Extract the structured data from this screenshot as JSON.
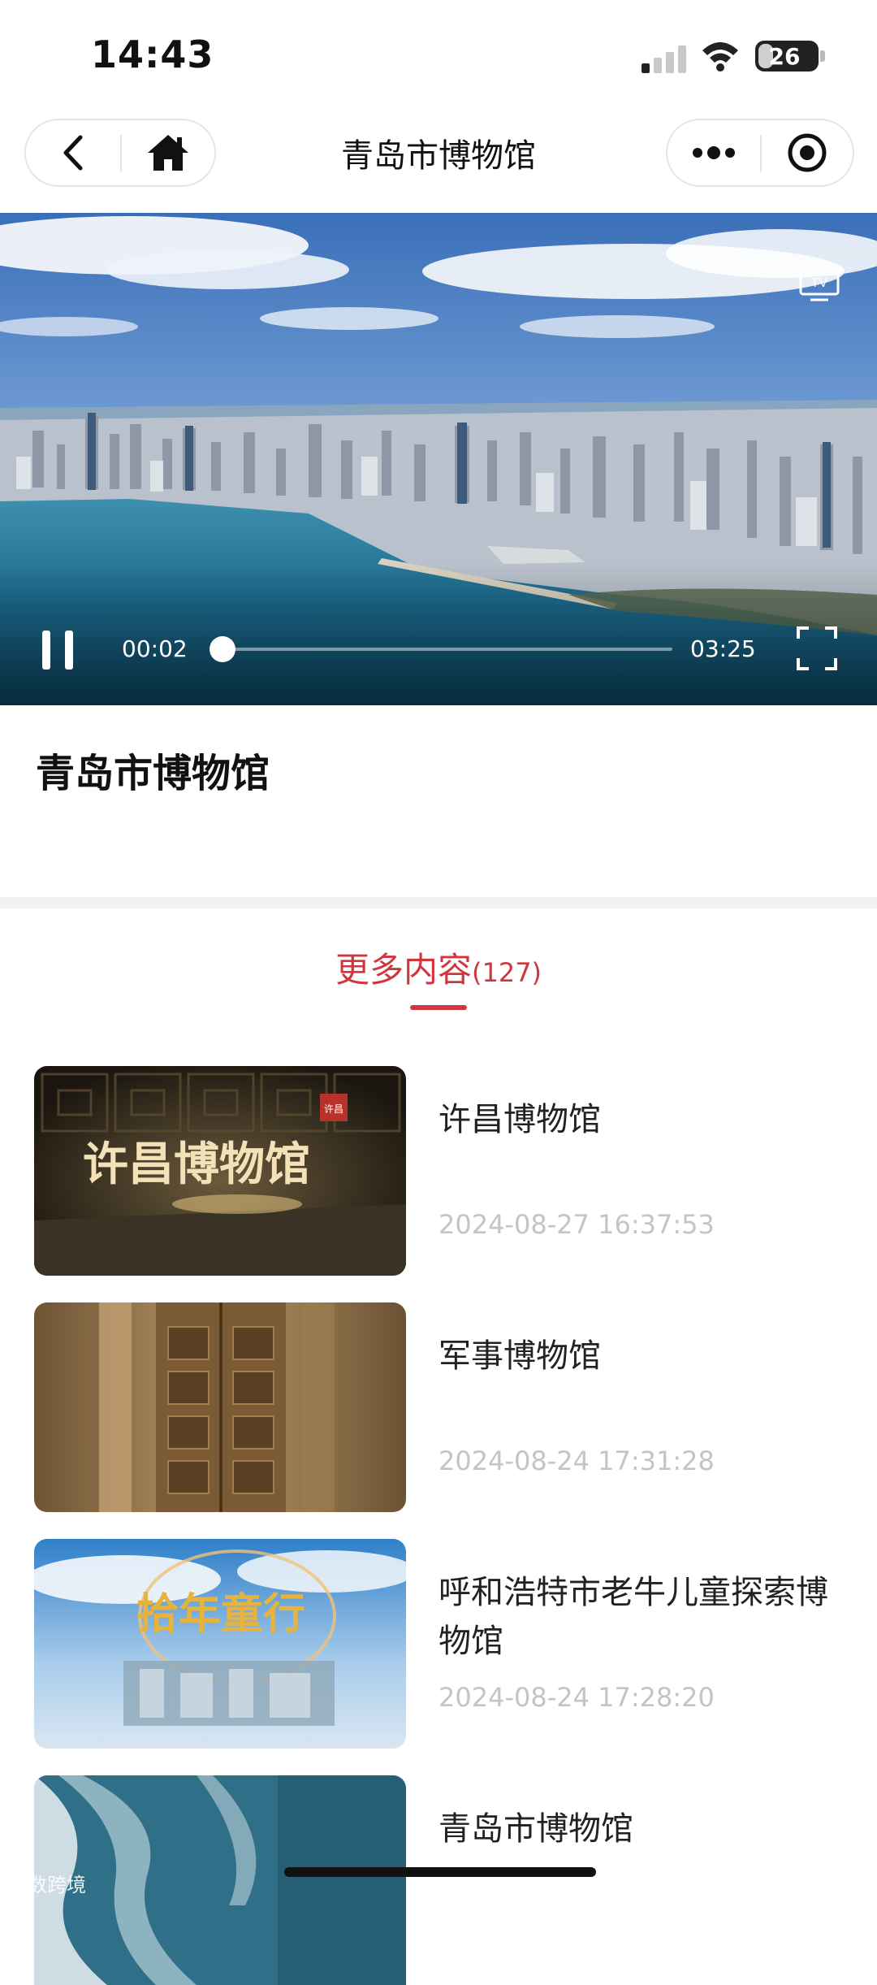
{
  "status_bar": {
    "time": "14:43",
    "battery": "26",
    "battery_level": 0.26
  },
  "nav": {
    "title": "青岛市博物馆",
    "icons": [
      "back-icon",
      "home-icon",
      "more-icon",
      "close-icon"
    ]
  },
  "video": {
    "current_time": "00:02",
    "total_time": "03:25",
    "progress": 0.01,
    "tv_label": "TV",
    "title": "青岛市博物馆"
  },
  "more": {
    "label": "更多内容",
    "count": "(127)"
  },
  "items": [
    {
      "title": "许昌博物馆",
      "date": "2024-08-27 16:37:53",
      "thumb_text": "许昌博物馆",
      "seal_text": "许昌"
    },
    {
      "title": "军事博物馆",
      "date": "2024-08-24 17:31:28"
    },
    {
      "title": "呼和浩特市老牛儿童探索博物馆",
      "date": "2024-08-24 17:28:20",
      "thumb_text": "拾年童行"
    },
    {
      "title": "青岛市博物馆",
      "date": ""
    }
  ],
  "watermark": "大数跨境",
  "colors": {
    "accent": "#d0373c",
    "date_gray": "#c4c4c4"
  }
}
